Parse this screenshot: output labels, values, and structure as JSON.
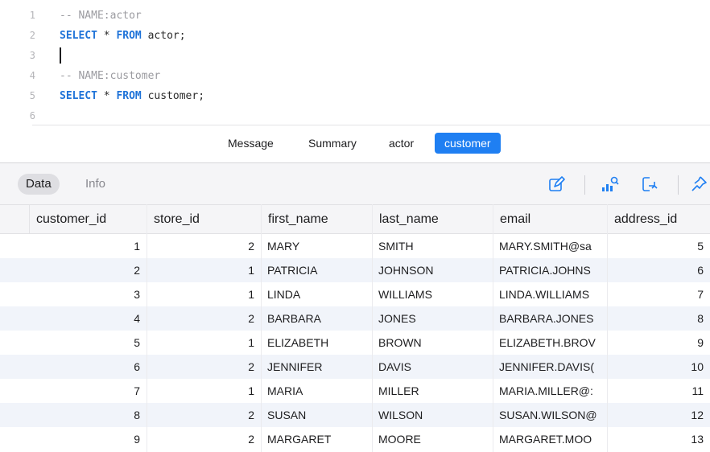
{
  "editor": {
    "lines": [
      {
        "n": "1",
        "parts": [
          {
            "cls": "cm",
            "t": "-- NAME:actor"
          }
        ]
      },
      {
        "n": "2",
        "parts": [
          {
            "cls": "kw",
            "t": "SELECT"
          },
          {
            "cls": "id",
            "t": " * "
          },
          {
            "cls": "kw",
            "t": "FROM"
          },
          {
            "cls": "id",
            "t": " actor;"
          }
        ]
      },
      {
        "n": "3",
        "parts": []
      },
      {
        "n": "4",
        "parts": [
          {
            "cls": "cm",
            "t": "-- NAME:customer"
          }
        ]
      },
      {
        "n": "5",
        "parts": [
          {
            "cls": "kw",
            "t": "SELECT"
          },
          {
            "cls": "id",
            "t": " * "
          },
          {
            "cls": "kw",
            "t": "FROM"
          },
          {
            "cls": "id",
            "t": " customer;"
          }
        ]
      },
      {
        "n": "6",
        "parts": []
      }
    ]
  },
  "result_tabs": {
    "message": "Message",
    "summary": "Summary",
    "actor": "actor",
    "customer": "customer",
    "active": "customer"
  },
  "toolbar": {
    "data": "Data",
    "info": "Info",
    "icons": [
      "edit-icon",
      "visualize-icon",
      "export-icon",
      "pin-icon"
    ]
  },
  "table": {
    "columns": [
      "customer_id",
      "store_id",
      "first_name",
      "last_name",
      "email",
      "address_id"
    ],
    "rows": [
      [
        "1",
        "2",
        "MARY",
        "SMITH",
        "MARY.SMITH@sa",
        "5"
      ],
      [
        "2",
        "1",
        "PATRICIA",
        "JOHNSON",
        "PATRICIA.JOHNS",
        "6"
      ],
      [
        "3",
        "1",
        "LINDA",
        "WILLIAMS",
        "LINDA.WILLIAMS",
        "7"
      ],
      [
        "4",
        "2",
        "BARBARA",
        "JONES",
        "BARBARA.JONES",
        "8"
      ],
      [
        "5",
        "1",
        "ELIZABETH",
        "BROWN",
        "ELIZABETH.BROV",
        "9"
      ],
      [
        "6",
        "2",
        "JENNIFER",
        "DAVIS",
        "JENNIFER.DAVIS(",
        "10"
      ],
      [
        "7",
        "1",
        "MARIA",
        "MILLER",
        "MARIA.MILLER@:",
        "11"
      ],
      [
        "8",
        "2",
        "SUSAN",
        "WILSON",
        "SUSAN.WILSON@",
        "12"
      ],
      [
        "9",
        "2",
        "MARGARET",
        "MOORE",
        "MARGARET.MOO",
        "13"
      ]
    ]
  },
  "colors": {
    "accent": "#1f7ff2",
    "keyword": "#1f73d8",
    "comment": "#9b9ba0",
    "row_alt": "#f1f4fa"
  }
}
